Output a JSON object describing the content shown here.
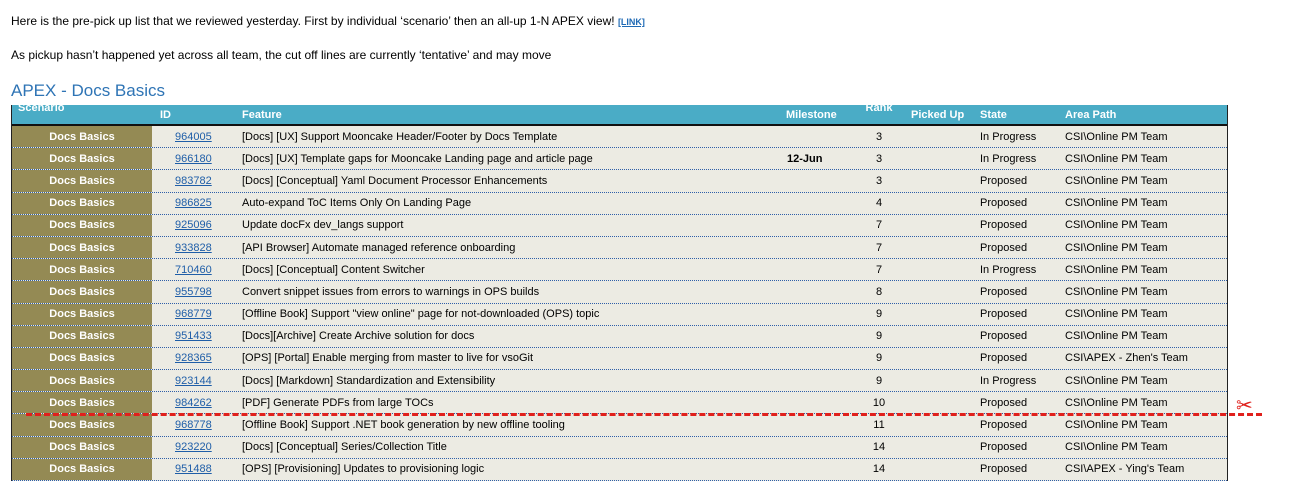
{
  "intro": {
    "line1": "Here is the pre-pick up list that we reviewed yesterday. First by individual ‘scenario’ then an all-up 1-N APEX view! ",
    "link": "[LINK]",
    "line2": "As pickup hasn’t happened yet across all team, the cut off lines are currently ‘tentative’ and may move"
  },
  "section_title": "APEX - Docs Basics",
  "table": {
    "headers": {
      "scenario": "Scenario",
      "id": "ID",
      "feature": "Feature",
      "milestone": "Milestone",
      "rank": "Rank",
      "picked_up": "Picked Up",
      "state": "State",
      "area_path": "Area Path"
    },
    "rows": [
      {
        "scenario": "Docs Basics",
        "id": "964005",
        "feature": "[Docs] [UX] Support Mooncake Header/Footer by Docs Template",
        "milestone": "",
        "rank": "3",
        "picked_up": "",
        "state": "In Progress",
        "area": "CSI\\Online PM Team"
      },
      {
        "scenario": "Docs Basics",
        "id": "966180",
        "feature": "[Docs] [UX] Template gaps for Mooncake Landing page and article page",
        "milestone": "12-Jun",
        "rank": "3",
        "picked_up": "",
        "state": "In Progress",
        "area": "CSI\\Online PM Team"
      },
      {
        "scenario": "Docs Basics",
        "id": "983782",
        "feature": "[Docs] [Conceptual] Yaml Document Processor Enhancements",
        "milestone": "",
        "rank": "3",
        "picked_up": "",
        "state": "Proposed",
        "area": "CSI\\Online PM Team"
      },
      {
        "scenario": "Docs Basics",
        "id": "986825",
        "feature": "Auto-expand ToC Items Only On Landing Page",
        "milestone": "",
        "rank": "4",
        "picked_up": "",
        "state": "Proposed",
        "area": "CSI\\Online PM Team"
      },
      {
        "scenario": "Docs Basics",
        "id": "925096",
        "feature": "Update docFx dev_langs support",
        "milestone": "",
        "rank": "7",
        "picked_up": "",
        "state": "Proposed",
        "area": "CSI\\Online PM Team"
      },
      {
        "scenario": "Docs Basics",
        "id": "933828",
        "feature": "[API Browser] Automate managed reference onboarding",
        "milestone": "",
        "rank": "7",
        "picked_up": "",
        "state": "Proposed",
        "area": "CSI\\Online PM Team"
      },
      {
        "scenario": "Docs Basics",
        "id": "710460",
        "feature": "[Docs] [Conceptual] Content Switcher",
        "milestone": "",
        "rank": "7",
        "picked_up": "",
        "state": "In Progress",
        "area": "CSI\\Online PM Team"
      },
      {
        "scenario": "Docs Basics",
        "id": "955798",
        "feature": "Convert snippet issues from errors to warnings in OPS builds",
        "milestone": "",
        "rank": "8",
        "picked_up": "",
        "state": "Proposed",
        "area": "CSI\\Online PM Team"
      },
      {
        "scenario": "Docs Basics",
        "id": "968779",
        "feature": "[Offline Book] Support \"view online\" page for not-downloaded (OPS) topic",
        "milestone": "",
        "rank": "9",
        "picked_up": "",
        "state": "Proposed",
        "area": "CSI\\Online PM Team"
      },
      {
        "scenario": "Docs Basics",
        "id": "951433",
        "feature": "[Docs][Archive] Create Archive solution for docs",
        "milestone": "",
        "rank": "9",
        "picked_up": "",
        "state": "Proposed",
        "area": "CSI\\Online PM Team"
      },
      {
        "scenario": "Docs Basics",
        "id": "928365",
        "feature": "[OPS] [Portal] Enable merging from master to live for vsoGit",
        "milestone": "",
        "rank": "9",
        "picked_up": "",
        "state": "Proposed",
        "area": "CSI\\APEX - Zhen's Team"
      },
      {
        "scenario": "Docs Basics",
        "id": "923144",
        "feature": "[Docs] [Markdown] Standardization and Extensibility",
        "milestone": "",
        "rank": "9",
        "picked_up": "",
        "state": "In Progress",
        "area": "CSI\\Online PM Team"
      },
      {
        "scenario": "Docs Basics",
        "id": "984262",
        "feature": "[PDF] Generate PDFs from large TOCs",
        "milestone": "",
        "rank": "10",
        "picked_up": "",
        "state": "Proposed",
        "area": "CSI\\Online PM Team"
      },
      {
        "scenario": "Docs Basics",
        "id": "968778",
        "feature": "[Offline Book] Support .NET book generation by new offline tooling",
        "milestone": "",
        "rank": "11",
        "picked_up": "",
        "state": "Proposed",
        "area": "CSI\\Online PM Team"
      },
      {
        "scenario": "Docs Basics",
        "id": "923220",
        "feature": "[Docs] [Conceptual] Series/Collection Title",
        "milestone": "",
        "rank": "14",
        "picked_up": "",
        "state": "Proposed",
        "area": "CSI\\Online PM Team"
      },
      {
        "scenario": "Docs Basics",
        "id": "951488",
        "feature": "[OPS] [Provisioning] Updates to provisioning logic",
        "milestone": "",
        "rank": "14",
        "picked_up": "",
        "state": "Proposed",
        "area": "CSI\\APEX - Ying's Team"
      }
    ]
  },
  "cutline": {
    "color": "#e0201c",
    "icon": "scissors-icon",
    "glyph": "✂"
  }
}
